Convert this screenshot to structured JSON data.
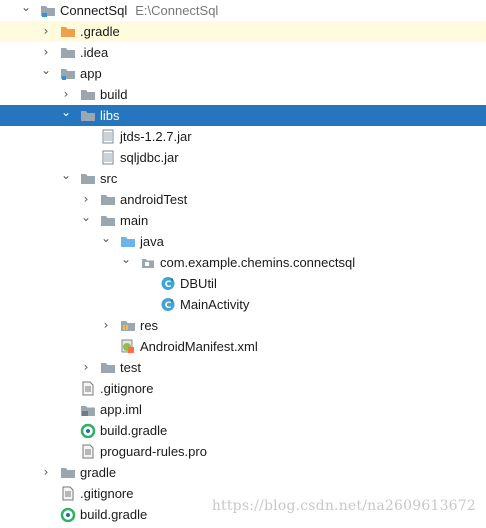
{
  "project": {
    "name": "ConnectSql",
    "path": "E:\\ConnectSql"
  },
  "tree": [
    {
      "level": 0,
      "arrow": "down",
      "icon": "project-module-icon",
      "label": "ConnectSql",
      "name": "tree-item-connectsql",
      "extra": "E:\\ConnectSql"
    },
    {
      "level": 1,
      "arrow": "right",
      "icon": "folder-orange-icon",
      "label": ".gradle",
      "name": "tree-item-gradle-dir",
      "hl": "yellow"
    },
    {
      "level": 1,
      "arrow": "right",
      "icon": "folder-icon",
      "label": ".idea",
      "name": "tree-item-idea"
    },
    {
      "level": 1,
      "arrow": "down",
      "icon": "module-folder-icon",
      "label": "app",
      "name": "tree-item-app"
    },
    {
      "level": 2,
      "arrow": "right",
      "icon": "folder-icon",
      "label": "build",
      "name": "tree-item-build"
    },
    {
      "level": 2,
      "arrow": "down",
      "icon": "folder-icon",
      "label": "libs",
      "name": "tree-item-libs",
      "selected": true
    },
    {
      "level": 3,
      "arrow": "",
      "icon": "jar-icon",
      "label": "jtds-1.2.7.jar",
      "name": "tree-item-jtds-jar"
    },
    {
      "level": 3,
      "arrow": "",
      "icon": "jar-icon",
      "label": "sqljdbc.jar",
      "name": "tree-item-sqljdbc-jar"
    },
    {
      "level": 2,
      "arrow": "down",
      "icon": "folder-icon",
      "label": "src",
      "name": "tree-item-src"
    },
    {
      "level": 3,
      "arrow": "right",
      "icon": "folder-icon",
      "label": "androidTest",
      "name": "tree-item-androidtest"
    },
    {
      "level": 3,
      "arrow": "down",
      "icon": "folder-icon",
      "label": "main",
      "name": "tree-item-main"
    },
    {
      "level": 4,
      "arrow": "down",
      "icon": "source-folder-icon",
      "label": "java",
      "name": "tree-item-java"
    },
    {
      "level": 5,
      "arrow": "down",
      "icon": "package-icon",
      "label": "com.example.chemins.connectsql",
      "name": "tree-item-package"
    },
    {
      "level": 6,
      "arrow": "",
      "icon": "class-icon",
      "label": "DBUtil",
      "name": "tree-item-dbutil"
    },
    {
      "level": 6,
      "arrow": "",
      "icon": "class-icon",
      "label": "MainActivity",
      "name": "tree-item-mainactivity"
    },
    {
      "level": 4,
      "arrow": "right",
      "icon": "resources-folder-icon",
      "label": "res",
      "name": "tree-item-res"
    },
    {
      "level": 4,
      "arrow": "",
      "icon": "manifest-icon",
      "label": "AndroidManifest.xml",
      "name": "tree-item-manifest"
    },
    {
      "level": 3,
      "arrow": "right",
      "icon": "folder-icon",
      "label": "test",
      "name": "tree-item-test"
    },
    {
      "level": 2,
      "arrow": "",
      "icon": "file-text-icon",
      "label": ".gitignore",
      "name": "tree-item-app-gitignore"
    },
    {
      "level": 2,
      "arrow": "",
      "icon": "iml-file-icon",
      "label": "app.iml",
      "name": "tree-item-app-iml"
    },
    {
      "level": 2,
      "arrow": "",
      "icon": "gradle-file-icon",
      "label": "build.gradle",
      "name": "tree-item-app-build-gradle"
    },
    {
      "level": 2,
      "arrow": "",
      "icon": "file-text-icon",
      "label": "proguard-rules.pro",
      "name": "tree-item-proguard"
    },
    {
      "level": 1,
      "arrow": "right",
      "icon": "folder-icon",
      "label": "gradle",
      "name": "tree-item-gradle"
    },
    {
      "level": 1,
      "arrow": "",
      "icon": "file-text-icon",
      "label": ".gitignore",
      "name": "tree-item-root-gitignore"
    },
    {
      "level": 1,
      "arrow": "",
      "icon": "gradle-file-icon",
      "label": "build.gradle",
      "name": "tree-item-root-build-gradle"
    }
  ],
  "watermark": "https://blog.csdn.net/na2609613672",
  "colors": {
    "selection": "#2675bf",
    "highlight": "#fffbdc",
    "folder": "#9aa7b0",
    "folder_orange": "#f0a04a",
    "source_folder": "#6bb6e6",
    "class_icon": "#3fa5d8"
  }
}
